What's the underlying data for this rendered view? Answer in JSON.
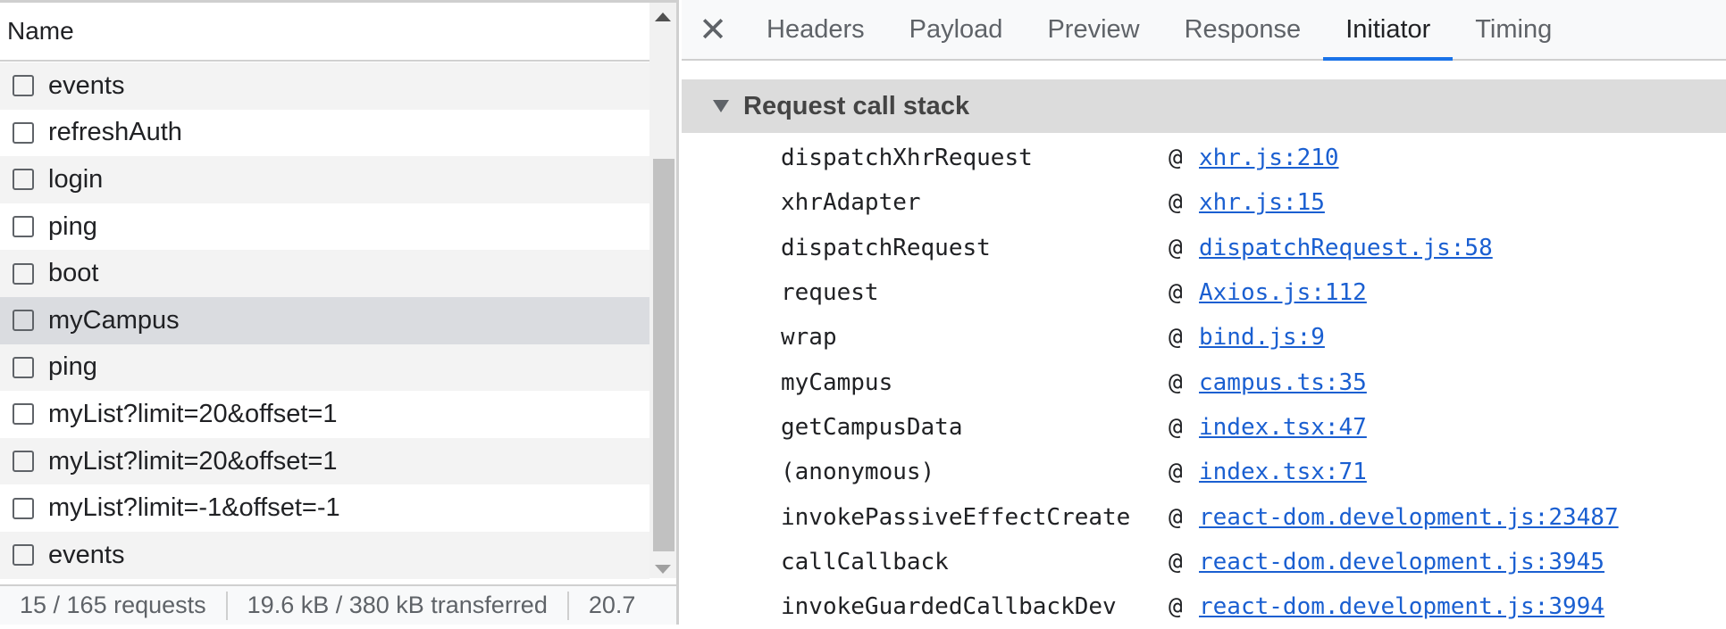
{
  "request_list": {
    "column_header": "Name",
    "rows": [
      {
        "name": "events"
      },
      {
        "name": "refreshAuth"
      },
      {
        "name": "login"
      },
      {
        "name": "ping"
      },
      {
        "name": "boot"
      },
      {
        "name": "myCampus",
        "selected": true
      },
      {
        "name": "ping"
      },
      {
        "name": "myList?limit=20&offset=1"
      },
      {
        "name": "myList?limit=20&offset=1"
      },
      {
        "name": "myList?limit=-1&offset=-1"
      },
      {
        "name": "events"
      }
    ],
    "status": {
      "requests": "15 / 165 requests",
      "transferred": "19.6 kB / 380 kB transferred",
      "resources": "20.7"
    }
  },
  "details": {
    "tabs": [
      {
        "label": "Headers"
      },
      {
        "label": "Payload"
      },
      {
        "label": "Preview"
      },
      {
        "label": "Response"
      },
      {
        "label": "Initiator",
        "active": true
      },
      {
        "label": "Timing"
      }
    ],
    "section_title": "Request call stack",
    "frames": [
      {
        "function": "dispatchXhrRequest",
        "at": "@",
        "location": "xhr.js:210"
      },
      {
        "function": "xhrAdapter",
        "at": "@",
        "location": "xhr.js:15"
      },
      {
        "function": "dispatchRequest",
        "at": "@",
        "location": "dispatchRequest.js:58"
      },
      {
        "function": "request",
        "at": "@",
        "location": "Axios.js:112"
      },
      {
        "function": "wrap",
        "at": "@",
        "location": "bind.js:9"
      },
      {
        "function": "myCampus",
        "at": "@",
        "location": "campus.ts:35"
      },
      {
        "function": "getCampusData",
        "at": "@",
        "location": "index.tsx:47"
      },
      {
        "function": "(anonymous)",
        "at": "@",
        "location": "index.tsx:71"
      },
      {
        "function": "invokePassiveEffectCreate",
        "at": "@",
        "location": "react-dom.development.js:23487"
      },
      {
        "function": "callCallback",
        "at": "@",
        "location": "react-dom.development.js:3945"
      },
      {
        "function": "invokeGuardedCallbackDev",
        "at": "@",
        "location": "react-dom.development.js:3994"
      }
    ]
  },
  "colors": {
    "accent": "#1a73e8",
    "link": "#1a5fd1",
    "selected_row": "#dadce0",
    "section_header": "#dcdcdc"
  },
  "icons": {
    "close": "close-icon",
    "section_toggle": "triangle-down-icon",
    "checkbox": "checkbox-icon"
  }
}
